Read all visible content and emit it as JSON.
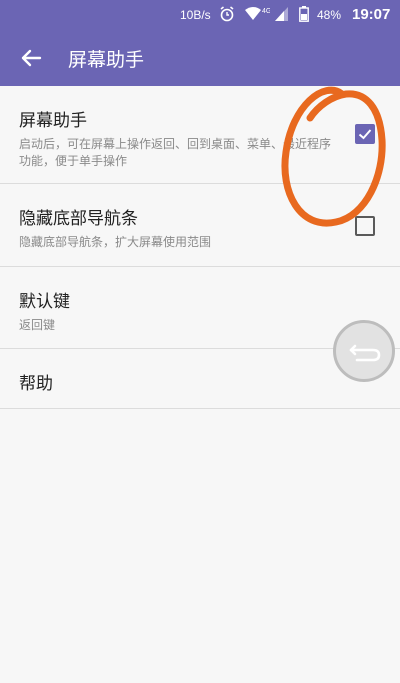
{
  "status_bar": {
    "network_speed": "10B/s",
    "network_type": "4G",
    "battery_percent": "48%",
    "time": "19:07",
    "icons": [
      "alarm-icon",
      "wifi-icon",
      "signal-icon",
      "battery-icon"
    ]
  },
  "toolbar": {
    "title": "屏幕助手",
    "back_icon": "arrow-left-icon"
  },
  "settings": [
    {
      "title": "屏幕助手",
      "summary": "启动后，可在屏幕上操作返回、回到桌面、菜单、最近程序功能，便于单手操作",
      "checked": true
    },
    {
      "title": "隐藏底部导航条",
      "summary": "隐藏底部导航条，扩大屏幕使用范围",
      "checked": false
    },
    {
      "title": "默认键",
      "summary": "返回键"
    },
    {
      "title": "帮助"
    }
  ],
  "floating_button": {
    "icon": "return-arrow-icon"
  },
  "colors": {
    "accent": "#6b65b4",
    "annotation": "#e8691f",
    "background": "#f7f7f7"
  }
}
